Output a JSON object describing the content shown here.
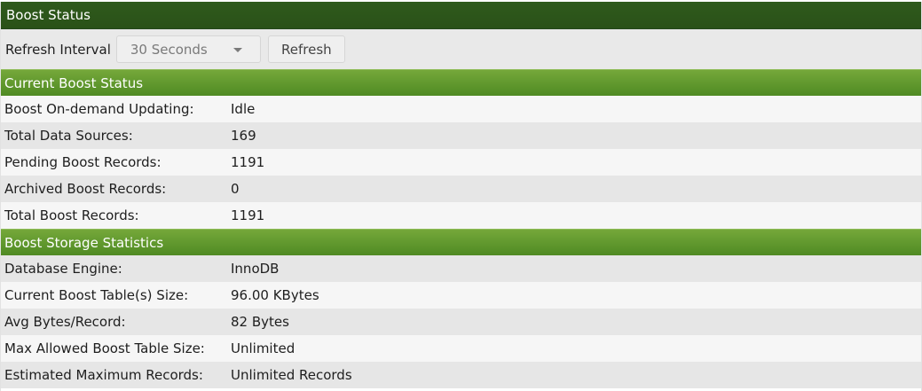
{
  "panel": {
    "title": "Boost Status"
  },
  "toolbar": {
    "refresh_interval_label": "Refresh Interval",
    "refresh_interval_value": "30 Seconds",
    "refresh_button": "Refresh"
  },
  "current_status": {
    "heading": "Current Boost Status",
    "rows": [
      {
        "label": "Boost On-demand Updating:",
        "value": "Idle"
      },
      {
        "label": "Total Data Sources:",
        "value": "169"
      },
      {
        "label": "Pending Boost Records:",
        "value": "1191"
      },
      {
        "label": "Archived Boost Records:",
        "value": "0"
      },
      {
        "label": "Total Boost Records:",
        "value": "1191"
      }
    ]
  },
  "storage_stats": {
    "heading": "Boost Storage Statistics",
    "rows": [
      {
        "label": "Database Engine:",
        "value": "InnoDB"
      },
      {
        "label": "Current Boost Table(s) Size:",
        "value": "96.00 KBytes"
      },
      {
        "label": "Avg Bytes/Record:",
        "value": "82 Bytes"
      },
      {
        "label": "Max Allowed Boost Table Size:",
        "value": "Unlimited"
      },
      {
        "label": "Estimated Maximum Records:",
        "value": "Unlimited Records"
      }
    ]
  },
  "colors": {
    "title_bar": "#2f5a1c",
    "section_header": "#5f962c",
    "row_light": "#f6f6f6",
    "row_dark": "#e6e6e6"
  }
}
